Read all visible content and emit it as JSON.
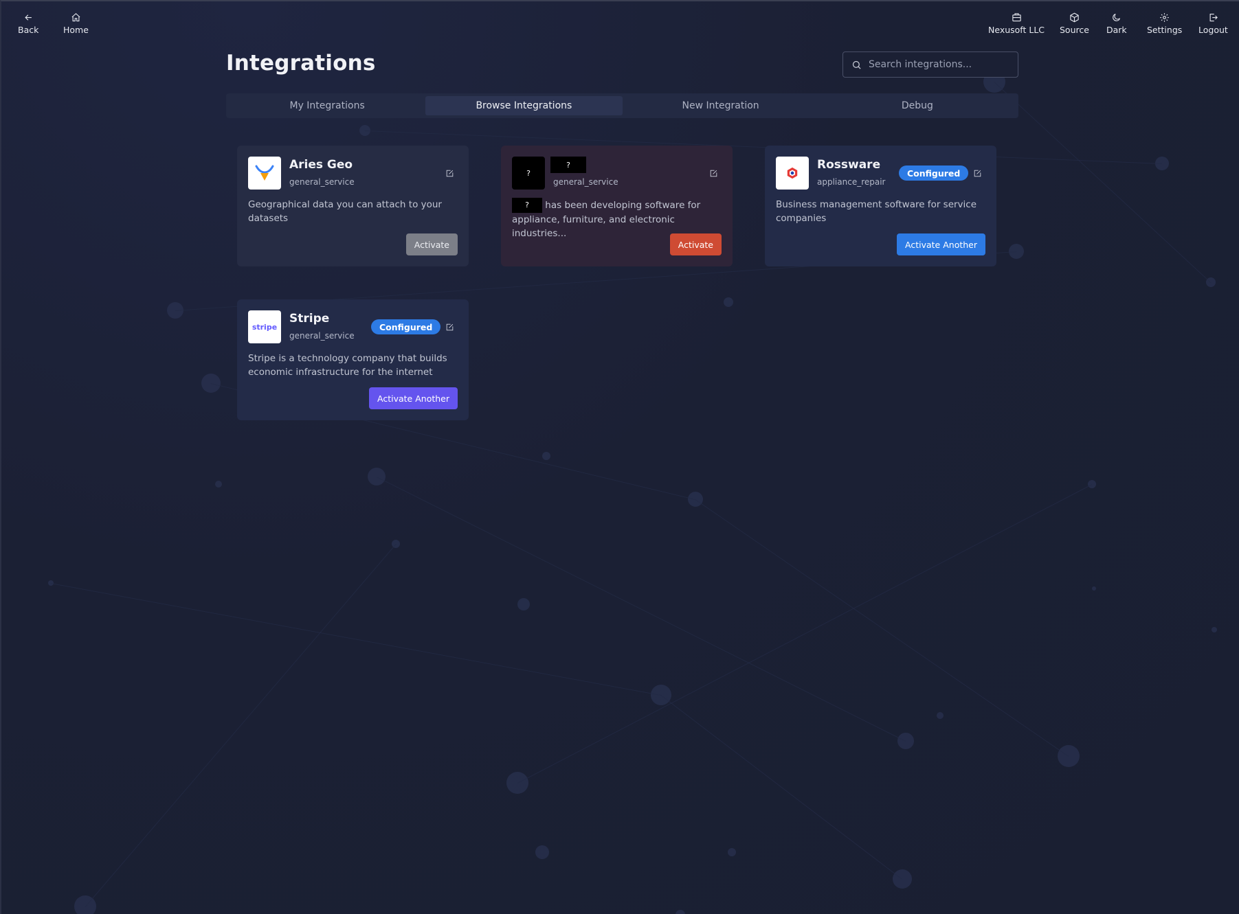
{
  "nav": {
    "back": "Back",
    "home": "Home",
    "org": "Nexusoft LLC",
    "source": "Source",
    "theme": "Dark",
    "settings": "Settings",
    "logout": "Logout"
  },
  "page": {
    "title": "Integrations",
    "search_placeholder": "Search integrations..."
  },
  "tabs": [
    {
      "label": "My Integrations",
      "active": false
    },
    {
      "label": "Browse Integrations",
      "active": true
    },
    {
      "label": "New Integration",
      "active": false
    },
    {
      "label": "Debug",
      "active": false
    }
  ],
  "cards": [
    {
      "title": "Aries Geo",
      "subtitle": "general_service",
      "description": "Geographical data you can attach to your datasets",
      "button": "Activate",
      "logo_icon": "aries-geo-logo-icon"
    },
    {
      "title": "?",
      "subtitle": "general_service",
      "redacted_name": "?",
      "description": "has been developing software for appliance, furniture, and electronic industries...",
      "button": "Activate",
      "logo_text": "?"
    },
    {
      "title": "Rossware",
      "subtitle": "appliance_repair",
      "badge": "Configured",
      "description": "Business management software for service companies",
      "button": "Activate Another",
      "logo_icon": "rossware-logo-icon"
    },
    {
      "title": "Stripe",
      "subtitle": "general_service",
      "badge": "Configured",
      "description": "Stripe is a technology company that builds economic infrastructure for the internet",
      "button": "Activate Another",
      "logo_text": "stripe"
    }
  ],
  "colors": {
    "background": "#1b2034",
    "configured_badge": "#2d7be5",
    "activate_red": "#cf4b33",
    "activate_gray": "#7c7f88",
    "activate_purple": "#6454ee"
  }
}
